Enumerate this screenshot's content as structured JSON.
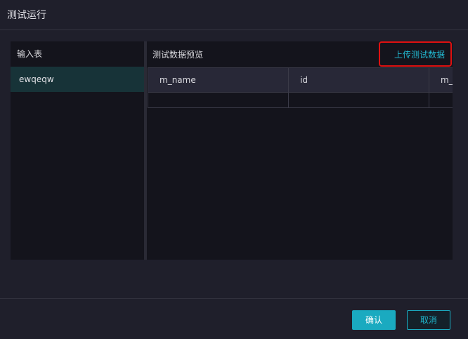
{
  "dialog": {
    "title": "测试运行"
  },
  "left_panel": {
    "heading": "输入表",
    "items": [
      {
        "label": "ewqeqw",
        "selected": true
      }
    ]
  },
  "right_panel": {
    "heading": "测试数据预览",
    "upload_label": "上传测试数据",
    "columns": [
      "m_name",
      "id",
      "m_t"
    ],
    "rows": [
      [
        "",
        "",
        ""
      ]
    ]
  },
  "footer": {
    "confirm_label": "确认",
    "cancel_label": "取消"
  },
  "colors": {
    "accent": "#1aaac0",
    "highlight_box": "#e01010",
    "selected_row": "#173338",
    "background": "#1f1f2b"
  }
}
